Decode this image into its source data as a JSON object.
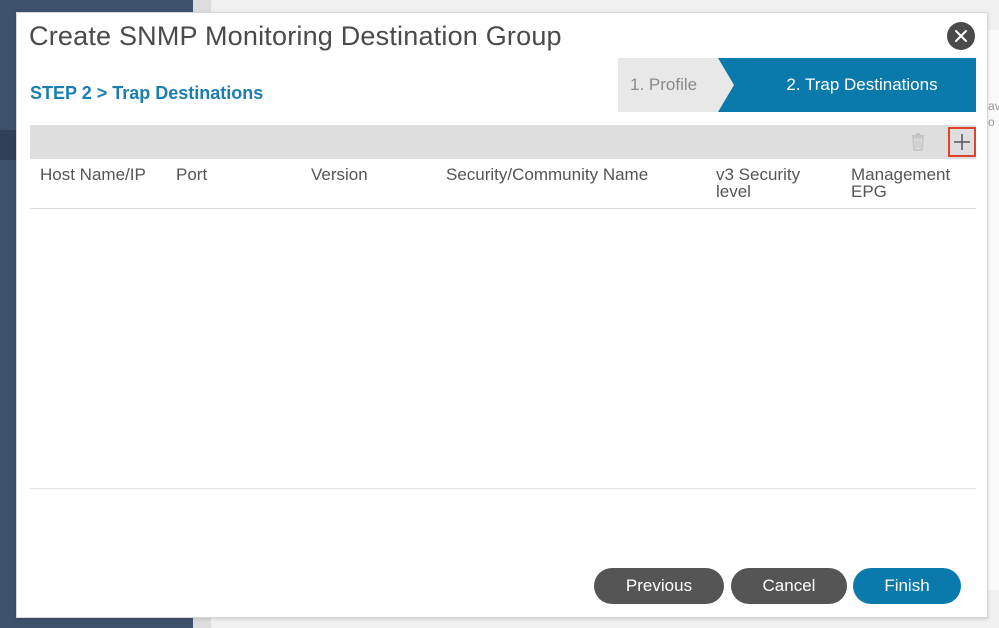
{
  "background": {
    "right_panel_text": [
      "av",
      "o"
    ]
  },
  "dialog": {
    "title": "Create SNMP Monitoring Destination Group",
    "close_icon": "close-icon",
    "step_label": "STEP 2 > Trap Destinations",
    "wizard": {
      "steps": [
        {
          "label": "1. Profile",
          "active": false
        },
        {
          "label": "2. Trap Destinations",
          "active": true
        }
      ]
    },
    "toolbar": {
      "delete_icon": "trash-icon",
      "add_icon": "plus-icon"
    },
    "table": {
      "columns": [
        {
          "label": "Host Name/IP"
        },
        {
          "label": "Port"
        },
        {
          "label": "Version"
        },
        {
          "label": "Security/Community Name"
        },
        {
          "label": "v3 Security level"
        },
        {
          "label": "Management EPG"
        }
      ],
      "rows": []
    },
    "buttons": {
      "previous": "Previous",
      "cancel": "Cancel",
      "finish": "Finish"
    }
  },
  "colors": {
    "accent": "#0a7aad",
    "step_label": "#1a7fb0",
    "highlight_border": "#e0422c",
    "secondary_button": "#555555"
  }
}
